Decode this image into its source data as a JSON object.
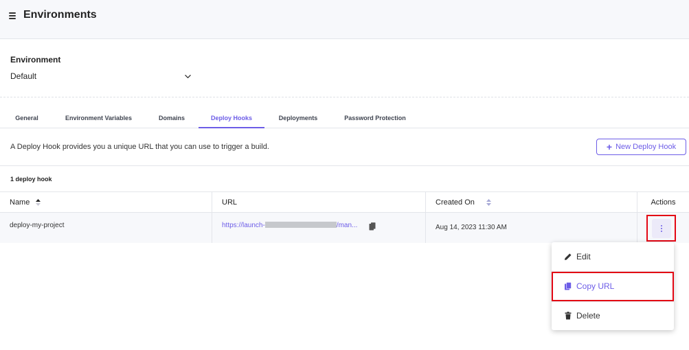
{
  "header": {
    "title": "Environments",
    "menu_icon": "hamburger-menu-icon"
  },
  "environment": {
    "label": "Environment",
    "value": "Default",
    "chevron_icon": "chevron-down-icon"
  },
  "tabs": [
    {
      "label": "General",
      "active": false
    },
    {
      "label": "Environment Variables",
      "active": false
    },
    {
      "label": "Domains",
      "active": false
    },
    {
      "label": "Deploy Hooks",
      "active": true
    },
    {
      "label": "Deployments",
      "active": false
    },
    {
      "label": "Password Protection",
      "active": false
    }
  ],
  "description": "A Deploy Hook provides you a unique URL that you can use to trigger a build.",
  "new_hook_button": {
    "label": "New Deploy Hook",
    "icon": "plus-icon"
  },
  "count_label": "1 deploy hook",
  "table": {
    "columns": [
      "Name",
      "URL",
      "Created On",
      "Actions"
    ],
    "rows": [
      {
        "name": "deploy-my-project",
        "url_prefix": "https://launch-",
        "url_suffix": "/man...",
        "created_on": "Aug 14, 2023 11:30 AM"
      }
    ]
  },
  "actions_menu": {
    "items": [
      {
        "label": "Edit",
        "icon": "pencil-icon"
      },
      {
        "label": "Copy URL",
        "icon": "copy-icon"
      },
      {
        "label": "Delete",
        "icon": "trash-icon"
      }
    ]
  },
  "colors": {
    "accent": "#6c5ce7",
    "highlight": "#e30613",
    "header_bg": "#f7f8fb",
    "border": "#e3e5ea"
  }
}
